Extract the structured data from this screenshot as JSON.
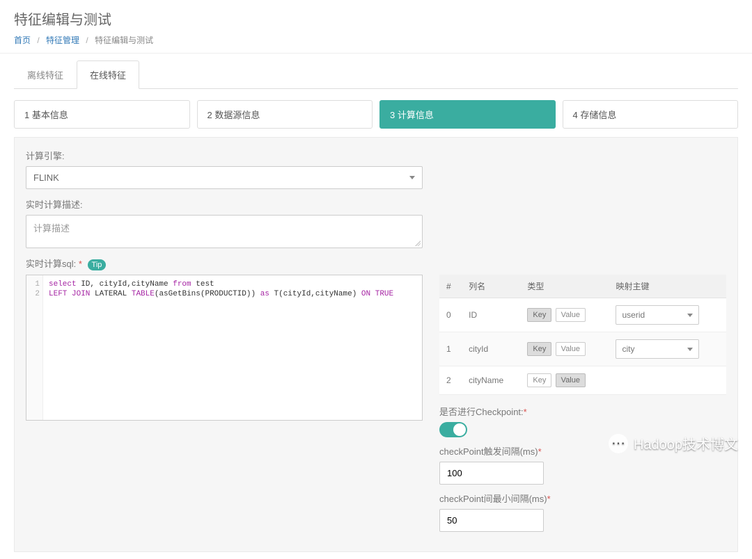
{
  "header": {
    "title": "特征编辑与测试",
    "breadcrumb": {
      "home": "首页",
      "manage": "特征管理",
      "current": "特征编辑与测试"
    }
  },
  "tabs": {
    "offline": "离线特征",
    "online": "在线特征"
  },
  "steps": {
    "s1": "1 基本信息",
    "s2": "2 数据源信息",
    "s3": "3 计算信息",
    "s4": "4 存储信息"
  },
  "form": {
    "engine_label": "计算引擎:",
    "engine_value": "FLINK",
    "desc_label": "实时计算描述:",
    "desc_placeholder": "计算描述",
    "sql_label": "实时计算sql:",
    "tip": "Tip",
    "sql_lines": {
      "l1": "1",
      "l2": "2"
    },
    "checkpoint_label": "是否进行Checkpoint:",
    "cp_interval_label": "checkPoint触发间隔(ms)",
    "cp_interval_value": "100",
    "cp_min_label": "checkPoint间最小间隔(ms)",
    "cp_min_value": "50"
  },
  "labels": {
    "key": "Key",
    "value": "Value"
  },
  "table": {
    "headers": {
      "idx": "#",
      "col": "列名",
      "type": "类型",
      "map": "映射主键"
    },
    "rows": [
      {
        "idx": "0",
        "col": "ID",
        "key_active": true,
        "map": "userid",
        "has_map": true
      },
      {
        "idx": "1",
        "col": "cityId",
        "key_active": true,
        "map": "city",
        "has_map": true
      },
      {
        "idx": "2",
        "col": "cityName",
        "key_active": false,
        "map": "",
        "has_map": false
      }
    ]
  },
  "watermark": {
    "text": "Hadoop技术博文",
    "icon": "⋯"
  }
}
